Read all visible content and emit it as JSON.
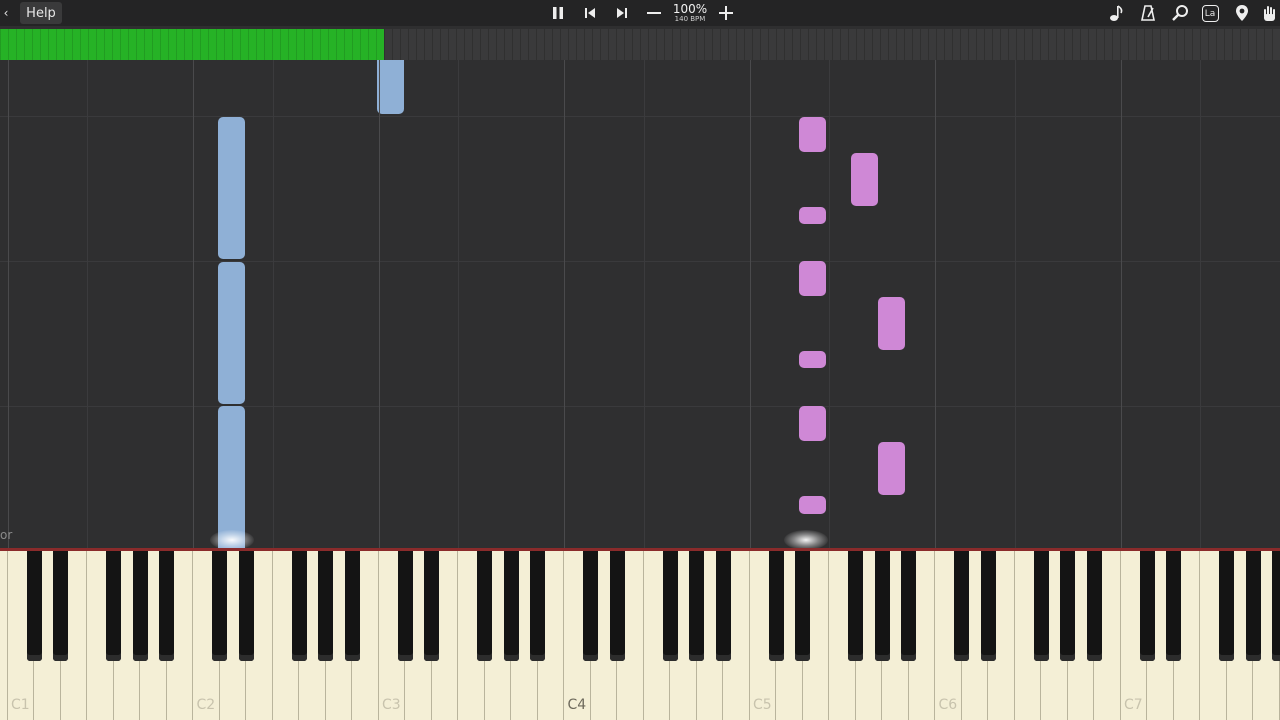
{
  "toolbar": {
    "back_glyph": "‹",
    "help_label": "Help",
    "speed_percent": "100%",
    "bpm": "140 BPM",
    "icons": [
      "pause-icon",
      "skip-back-icon",
      "skip-forward-icon",
      "zoom-out-icon",
      "zoom-in-icon",
      "note-icon",
      "metronome-icon",
      "search-icon",
      "label-icon",
      "location-icon",
      "hand-icon"
    ],
    "label_icon_text": "La"
  },
  "progress": {
    "fraction": 0.3
  },
  "corner_text": "or",
  "octave_labels": [
    "C1",
    "C2",
    "C3",
    "C4",
    "C5",
    "C6",
    "C7"
  ],
  "colors": {
    "left_hand": "#8fb0d6",
    "right_hand": "#cf88d6",
    "progress": "#26b226",
    "background": "#2f2f30"
  }
}
